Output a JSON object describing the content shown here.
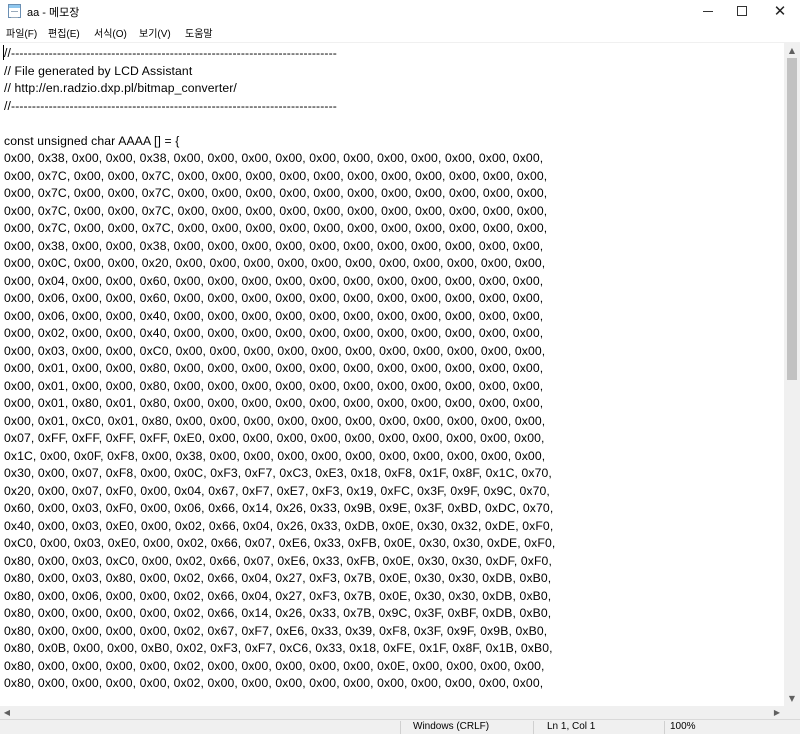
{
  "window": {
    "title": "aa - 메모장",
    "icon": "notepad-icon",
    "controls": [
      "minimize-icon",
      "maximize-icon",
      "close-icon"
    ]
  },
  "menu": {
    "items": [
      {
        "label": "파일(F)"
      },
      {
        "label": "편집(E)"
      },
      {
        "label": "서식(O)"
      },
      {
        "label": "보기(V)"
      },
      {
        "label": "도움말"
      }
    ]
  },
  "editor": {
    "content": "//------------------------------------------------------------------------------\n// File generated by LCD Assistant\n// http://en.radzio.dxp.pl/bitmap_converter/\n//------------------------------------------------------------------------------\n\nconst unsigned char AAAA [] = {\n0x00, 0x38, 0x00, 0x00, 0x38, 0x00, 0x00, 0x00, 0x00, 0x00, 0x00, 0x00, 0x00, 0x00, 0x00, 0x00,\n0x00, 0x7C, 0x00, 0x00, 0x7C, 0x00, 0x00, 0x00, 0x00, 0x00, 0x00, 0x00, 0x00, 0x00, 0x00, 0x00,\n0x00, 0x7C, 0x00, 0x00, 0x7C, 0x00, 0x00, 0x00, 0x00, 0x00, 0x00, 0x00, 0x00, 0x00, 0x00, 0x00,\n0x00, 0x7C, 0x00, 0x00, 0x7C, 0x00, 0x00, 0x00, 0x00, 0x00, 0x00, 0x00, 0x00, 0x00, 0x00, 0x00,\n0x00, 0x7C, 0x00, 0x00, 0x7C, 0x00, 0x00, 0x00, 0x00, 0x00, 0x00, 0x00, 0x00, 0x00, 0x00, 0x00,\n0x00, 0x38, 0x00, 0x00, 0x38, 0x00, 0x00, 0x00, 0x00, 0x00, 0x00, 0x00, 0x00, 0x00, 0x00, 0x00,\n0x00, 0x0C, 0x00, 0x00, 0x20, 0x00, 0x00, 0x00, 0x00, 0x00, 0x00, 0x00, 0x00, 0x00, 0x00, 0x00,\n0x00, 0x04, 0x00, 0x00, 0x60, 0x00, 0x00, 0x00, 0x00, 0x00, 0x00, 0x00, 0x00, 0x00, 0x00, 0x00,\n0x00, 0x06, 0x00, 0x00, 0x60, 0x00, 0x00, 0x00, 0x00, 0x00, 0x00, 0x00, 0x00, 0x00, 0x00, 0x00,\n0x00, 0x06, 0x00, 0x00, 0x40, 0x00, 0x00, 0x00, 0x00, 0x00, 0x00, 0x00, 0x00, 0x00, 0x00, 0x00,\n0x00, 0x02, 0x00, 0x00, 0x40, 0x00, 0x00, 0x00, 0x00, 0x00, 0x00, 0x00, 0x00, 0x00, 0x00, 0x00,\n0x00, 0x03, 0x00, 0x00, 0xC0, 0x00, 0x00, 0x00, 0x00, 0x00, 0x00, 0x00, 0x00, 0x00, 0x00, 0x00,\n0x00, 0x01, 0x00, 0x00, 0x80, 0x00, 0x00, 0x00, 0x00, 0x00, 0x00, 0x00, 0x00, 0x00, 0x00, 0x00,\n0x00, 0x01, 0x00, 0x00, 0x80, 0x00, 0x00, 0x00, 0x00, 0x00, 0x00, 0x00, 0x00, 0x00, 0x00, 0x00,\n0x00, 0x01, 0x80, 0x01, 0x80, 0x00, 0x00, 0x00, 0x00, 0x00, 0x00, 0x00, 0x00, 0x00, 0x00, 0x00,\n0x00, 0x01, 0xC0, 0x01, 0x80, 0x00, 0x00, 0x00, 0x00, 0x00, 0x00, 0x00, 0x00, 0x00, 0x00, 0x00,\n0x07, 0xFF, 0xFF, 0xFF, 0xFF, 0xE0, 0x00, 0x00, 0x00, 0x00, 0x00, 0x00, 0x00, 0x00, 0x00, 0x00,\n0x1C, 0x00, 0x0F, 0xF8, 0x00, 0x38, 0x00, 0x00, 0x00, 0x00, 0x00, 0x00, 0x00, 0x00, 0x00, 0x00,\n0x30, 0x00, 0x07, 0xF8, 0x00, 0x0C, 0xF3, 0xF7, 0xC3, 0xE3, 0x18, 0xF8, 0x1F, 0x8F, 0x1C, 0x70,\n0x20, 0x00, 0x07, 0xF0, 0x00, 0x04, 0x67, 0xF7, 0xE7, 0xF3, 0x19, 0xFC, 0x3F, 0x9F, 0x9C, 0x70,\n0x60, 0x00, 0x03, 0xF0, 0x00, 0x06, 0x66, 0x14, 0x26, 0x33, 0x9B, 0x9E, 0x3F, 0xBD, 0xDC, 0x70,\n0x40, 0x00, 0x03, 0xE0, 0x00, 0x02, 0x66, 0x04, 0x26, 0x33, 0xDB, 0x0E, 0x30, 0x32, 0xDE, 0xF0,\n0xC0, 0x00, 0x03, 0xE0, 0x00, 0x02, 0x66, 0x07, 0xE6, 0x33, 0xFB, 0x0E, 0x30, 0x30, 0xDE, 0xF0,\n0x80, 0x00, 0x03, 0xC0, 0x00, 0x02, 0x66, 0x07, 0xE6, 0x33, 0xFB, 0x0E, 0x30, 0x30, 0xDF, 0xF0,\n0x80, 0x00, 0x03, 0x80, 0x00, 0x02, 0x66, 0x04, 0x27, 0xF3, 0x7B, 0x0E, 0x30, 0x30, 0xDB, 0xB0,\n0x80, 0x00, 0x06, 0x00, 0x00, 0x02, 0x66, 0x04, 0x27, 0xF3, 0x7B, 0x0E, 0x30, 0x30, 0xDB, 0xB0,\n0x80, 0x00, 0x00, 0x00, 0x00, 0x02, 0x66, 0x14, 0x26, 0x33, 0x7B, 0x9C, 0x3F, 0xBF, 0xDB, 0xB0,\n0x80, 0x00, 0x00, 0x00, 0x00, 0x02, 0x67, 0xF7, 0xE6, 0x33, 0x39, 0xF8, 0x3F, 0x9F, 0x9B, 0xB0,\n0x80, 0x0B, 0x00, 0x00, 0xB0, 0x02, 0xF3, 0xF7, 0xC6, 0x33, 0x18, 0xFE, 0x1F, 0x8F, 0x1B, 0xB0,\n0x80, 0x00, 0x00, 0x00, 0x00, 0x02, 0x00, 0x00, 0x00, 0x00, 0x00, 0x0E, 0x00, 0x00, 0x00, 0x00,\n0x80, 0x00, 0x00, 0x00, 0x00, 0x02, 0x00, 0x00, 0x00, 0x00, 0x00, 0x00, 0x00, 0x00, 0x00, 0x00,"
  },
  "statusbar": {
    "encoding": "Windows (CRLF)",
    "position": "Ln 1, Col 1",
    "zoom": "100%"
  },
  "colors": {
    "scrollbar_track": "#f0f0f0",
    "scrollbar_thumb": "#c2c2c2",
    "statusbar_bg": "#f0f0f0"
  }
}
